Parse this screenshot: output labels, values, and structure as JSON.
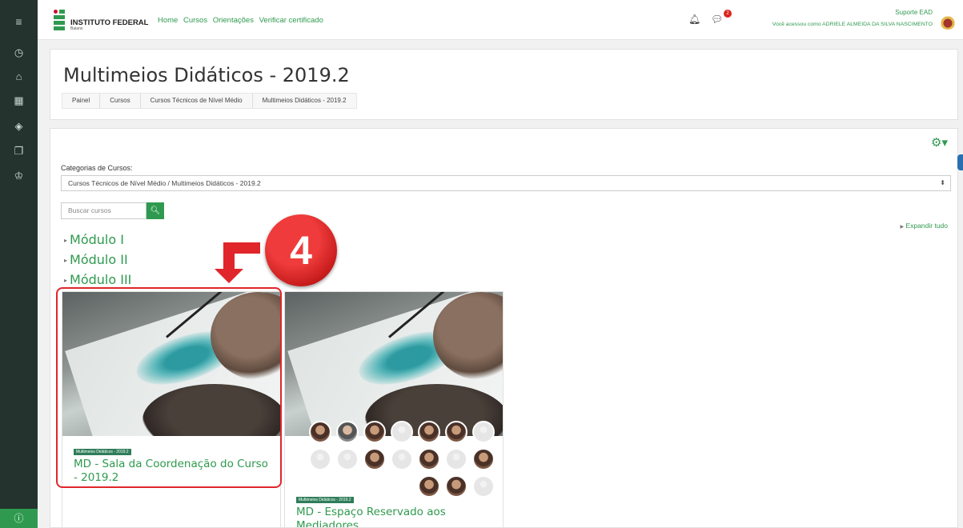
{
  "sidebar": {
    "icons": [
      "menu-icon",
      "dashboard-icon",
      "home-icon",
      "calendar-icon",
      "layers-icon",
      "files-icon",
      "graduation-cap-icon",
      "info-icon"
    ]
  },
  "topbar": {
    "logo_text": "INSTITUTO FEDERAL",
    "logo_subtext": "Baiano",
    "nav": [
      "Home",
      "Cursos",
      "Orientações",
      "Verificar certificado"
    ],
    "message_badge": "2",
    "user_top": "Suporte EAD",
    "user_bottom": "Você acessou como ADRIELE ALMEIDA DA SILVA NASCIMENTO"
  },
  "header": {
    "title": "Multimeios Didáticos - 2019.2",
    "breadcrumb": [
      "Painel",
      "Cursos",
      "Cursos Técnicos de Nível Médio",
      "Multimeios Didáticos - 2019.2"
    ]
  },
  "main": {
    "category_label": "Categorias de Cursos:",
    "category_value": "Cursos Técnicos de Nível Médio / Multimeios Didáticos - 2019.2",
    "search_placeholder": "Buscar cursos",
    "expand_all": "Expandir tudo",
    "modules": [
      "Módulo I",
      "Módulo II",
      "Módulo III"
    ],
    "courses": [
      {
        "tag": "Multimeios Didáticos - 2019.2",
        "name": "MD - Sala da Coordenação do Curso - 2019.2"
      },
      {
        "tag": "Multimeios Didáticos - 2019.2",
        "name": "MD - Espaço Reservado aos Mediadores"
      }
    ]
  },
  "annotation": {
    "step_number": "4"
  },
  "colors": {
    "accent": "#2f9a4f",
    "sidebar_bg": "#24332d",
    "highlight": "#e0262a"
  }
}
